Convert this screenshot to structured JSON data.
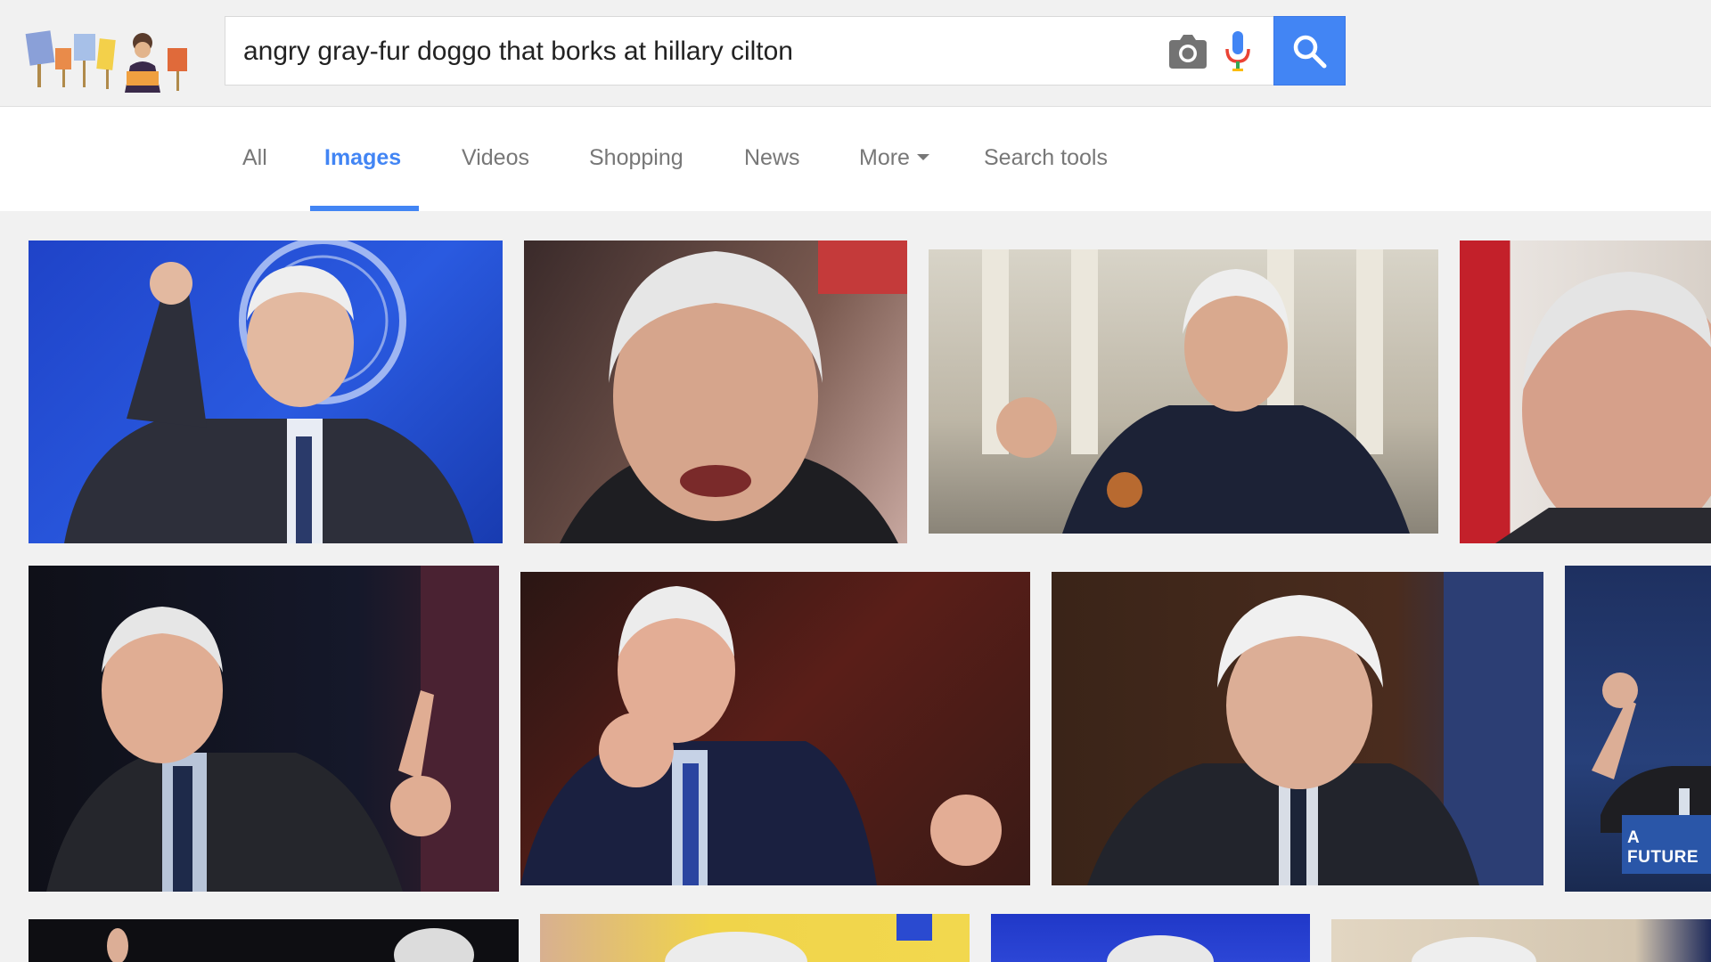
{
  "search": {
    "query": "angry gray-fur doggo that borks at hillary cilton"
  },
  "icons": {
    "camera": "camera-icon",
    "mic": "microphone-icon",
    "search": "magnifier-icon"
  },
  "colors": {
    "accent": "#4285f4",
    "tab_text": "#777777",
    "page_bg": "#f1f1f1"
  },
  "tabs": [
    {
      "label": "All",
      "active": false
    },
    {
      "label": "Images",
      "active": true
    },
    {
      "label": "Videos",
      "active": false
    },
    {
      "label": "Shopping",
      "active": false
    },
    {
      "label": "News",
      "active": false
    },
    {
      "label": "More",
      "active": false
    },
    {
      "label": "Search tools",
      "active": false
    }
  ],
  "results": {
    "row2_sign_text": "A FUTURE"
  }
}
